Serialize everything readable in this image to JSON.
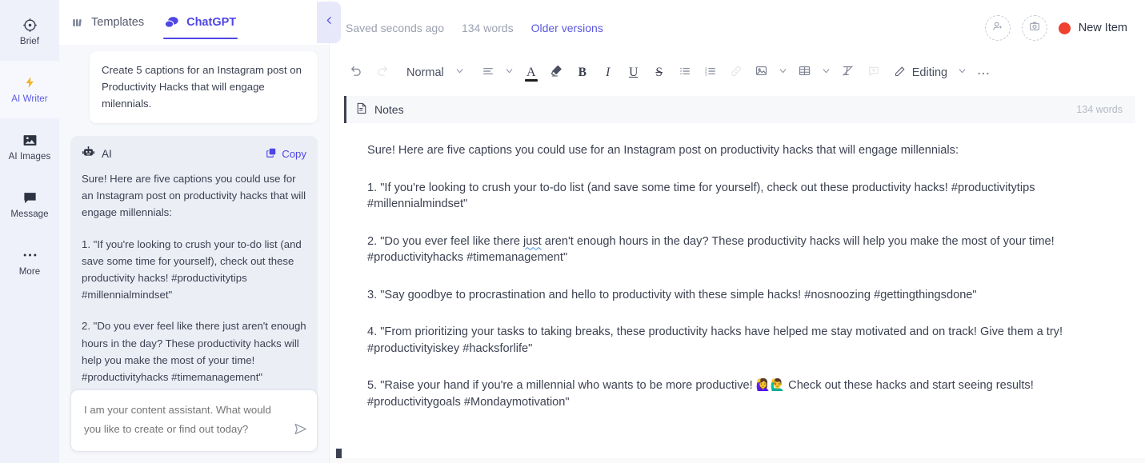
{
  "rail": {
    "items": [
      {
        "label": "Brief",
        "icon": "target-icon",
        "active": false
      },
      {
        "label": "AI Writer",
        "icon": "bolt-icon",
        "active": true
      },
      {
        "label": "AI Images",
        "icon": "image-icon",
        "active": false
      },
      {
        "label": "Message",
        "icon": "chat-icon",
        "active": false
      },
      {
        "label": "More",
        "icon": "ellipsis-icon",
        "active": false
      }
    ]
  },
  "chat": {
    "tabs": [
      {
        "label": "Templates",
        "icon": "templates-icon",
        "active": false
      },
      {
        "label": "ChatGPT",
        "icon": "chat-bubbles-icon",
        "active": true
      }
    ],
    "collapse_icon": "chevron-left-icon",
    "user_message": "Create 5 captions for an Instagram post on Productivity Hacks that will engage milennials.",
    "ai": {
      "name": "AI",
      "avatar_icon": "robot-icon",
      "copy_label": "Copy",
      "copy_icon": "copy-icon",
      "paragraphs": [
        "Sure! Here are five captions you could use for an Instagram post on productivity hacks that will engage millennials:",
        "1. \"If you're looking to crush your to-do list (and save some time for yourself), check out these productivity hacks! #productivitytips #millennialmindset\"",
        "2. \"Do you ever feel like there just aren't enough hours in the day? These productivity hacks will help you make the most of your time! #productivityhacks #timemanagement\""
      ]
    },
    "composer": {
      "placeholder": "I am your content assistant. What would you like to create or find out today?",
      "value": "",
      "send_icon": "send-icon"
    }
  },
  "editor": {
    "status": {
      "saved": "Saved seconds ago",
      "word_count": "134 words",
      "older_versions": "Older versions"
    },
    "actions": {
      "invite_icon": "add-person-icon",
      "media_icon": "add-image-icon",
      "new_item_label": "New Item",
      "new_item_dot_color": "#f0402f"
    },
    "toolbar": {
      "undo_icon": "undo-icon",
      "redo_icon": "redo-icon",
      "style_label": "Normal",
      "style_chevron_icon": "chevron-down-icon",
      "align_icon": "align-left-icon",
      "align_chevron_icon": "chevron-down-icon",
      "text_color_icon": "text-color-icon",
      "text_color_swatch": "#1c1c1c",
      "highlight_icon": "highlighter-icon",
      "bold_icon": "bold-icon",
      "italic_icon": "italic-icon",
      "underline_icon": "underline-icon",
      "strikethrough_icon": "strikethrough-icon",
      "bullet_list_icon": "bullet-list-icon",
      "numbered_list_icon": "numbered-list-icon",
      "link_icon": "link-icon",
      "image_icon": "image-icon",
      "image_chevron_icon": "chevron-down-icon",
      "table_icon": "table-icon",
      "table_chevron_icon": "chevron-down-icon",
      "clear_format_icon": "clear-format-icon",
      "comment_icon": "add-comment-icon",
      "mode_icon": "pencil-icon",
      "mode_label": "Editing",
      "mode_chevron_icon": "chevron-down-icon",
      "more_icon": "ellipsis-icon"
    },
    "section": {
      "icon": "document-icon",
      "title": "Notes",
      "word_count": "134 words",
      "accent_color": "#3c4152"
    },
    "document": {
      "paragraphs": [
        {
          "text": "Sure! Here are five captions you could use for an Instagram post on productivity hacks that will engage millennials:"
        },
        {
          "text": "1. \"If you're looking to crush your to-do list (and save some time for yourself), check out these productivity hacks! #productivitytips #millennialmindset\""
        },
        {
          "pre": "2. \"Do you ever feel like there ",
          "flagged": "just",
          "post": " aren't enough hours in the day? These productivity hacks will help you make the most of your time! #productivityhacks #timemanagement\""
        },
        {
          "text": "3. \"Say goodbye to procrastination and hello to productivity with these simple hacks! #nosnoozing #gettingthingsdone\""
        },
        {
          "text": "4. \"From prioritizing your tasks to taking breaks, these productivity hacks have helped me stay motivated and on track! Give them a try! #productivityiskey #hacksforlife\""
        },
        {
          "text": "5. \"Raise your hand if you're a millennial who wants to be more productive! 🙋‍♀️🙋‍♂️ Check out these hacks and start seeing results! #productivitygoals #Mondaymotivation\""
        }
      ]
    }
  }
}
